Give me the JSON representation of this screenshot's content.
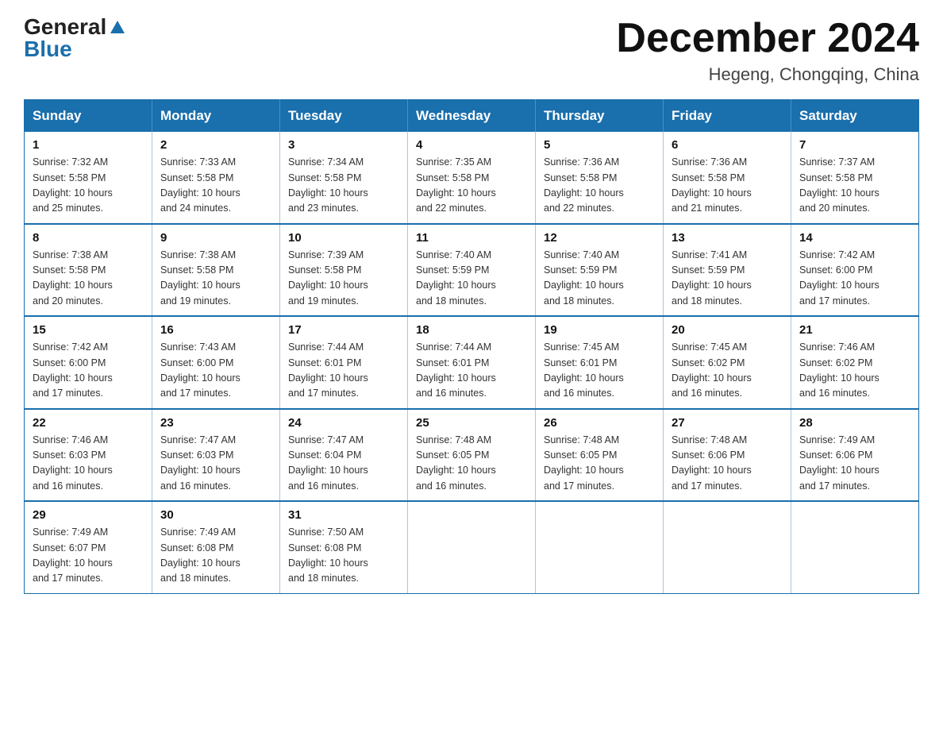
{
  "header": {
    "logo_general": "General",
    "logo_blue": "Blue",
    "month_title": "December 2024",
    "location": "Hegeng, Chongqing, China"
  },
  "weekdays": [
    "Sunday",
    "Monday",
    "Tuesday",
    "Wednesday",
    "Thursday",
    "Friday",
    "Saturday"
  ],
  "weeks": [
    [
      {
        "day": "1",
        "sunrise": "7:32 AM",
        "sunset": "5:58 PM",
        "daylight": "10 hours and 25 minutes."
      },
      {
        "day": "2",
        "sunrise": "7:33 AM",
        "sunset": "5:58 PM",
        "daylight": "10 hours and 24 minutes."
      },
      {
        "day": "3",
        "sunrise": "7:34 AM",
        "sunset": "5:58 PM",
        "daylight": "10 hours and 23 minutes."
      },
      {
        "day": "4",
        "sunrise": "7:35 AM",
        "sunset": "5:58 PM",
        "daylight": "10 hours and 22 minutes."
      },
      {
        "day": "5",
        "sunrise": "7:36 AM",
        "sunset": "5:58 PM",
        "daylight": "10 hours and 22 minutes."
      },
      {
        "day": "6",
        "sunrise": "7:36 AM",
        "sunset": "5:58 PM",
        "daylight": "10 hours and 21 minutes."
      },
      {
        "day": "7",
        "sunrise": "7:37 AM",
        "sunset": "5:58 PM",
        "daylight": "10 hours and 20 minutes."
      }
    ],
    [
      {
        "day": "8",
        "sunrise": "7:38 AM",
        "sunset": "5:58 PM",
        "daylight": "10 hours and 20 minutes."
      },
      {
        "day": "9",
        "sunrise": "7:38 AM",
        "sunset": "5:58 PM",
        "daylight": "10 hours and 19 minutes."
      },
      {
        "day": "10",
        "sunrise": "7:39 AM",
        "sunset": "5:58 PM",
        "daylight": "10 hours and 19 minutes."
      },
      {
        "day": "11",
        "sunrise": "7:40 AM",
        "sunset": "5:59 PM",
        "daylight": "10 hours and 18 minutes."
      },
      {
        "day": "12",
        "sunrise": "7:40 AM",
        "sunset": "5:59 PM",
        "daylight": "10 hours and 18 minutes."
      },
      {
        "day": "13",
        "sunrise": "7:41 AM",
        "sunset": "5:59 PM",
        "daylight": "10 hours and 18 minutes."
      },
      {
        "day": "14",
        "sunrise": "7:42 AM",
        "sunset": "6:00 PM",
        "daylight": "10 hours and 17 minutes."
      }
    ],
    [
      {
        "day": "15",
        "sunrise": "7:42 AM",
        "sunset": "6:00 PM",
        "daylight": "10 hours and 17 minutes."
      },
      {
        "day": "16",
        "sunrise": "7:43 AM",
        "sunset": "6:00 PM",
        "daylight": "10 hours and 17 minutes."
      },
      {
        "day": "17",
        "sunrise": "7:44 AM",
        "sunset": "6:01 PM",
        "daylight": "10 hours and 17 minutes."
      },
      {
        "day": "18",
        "sunrise": "7:44 AM",
        "sunset": "6:01 PM",
        "daylight": "10 hours and 16 minutes."
      },
      {
        "day": "19",
        "sunrise": "7:45 AM",
        "sunset": "6:01 PM",
        "daylight": "10 hours and 16 minutes."
      },
      {
        "day": "20",
        "sunrise": "7:45 AM",
        "sunset": "6:02 PM",
        "daylight": "10 hours and 16 minutes."
      },
      {
        "day": "21",
        "sunrise": "7:46 AM",
        "sunset": "6:02 PM",
        "daylight": "10 hours and 16 minutes."
      }
    ],
    [
      {
        "day": "22",
        "sunrise": "7:46 AM",
        "sunset": "6:03 PM",
        "daylight": "10 hours and 16 minutes."
      },
      {
        "day": "23",
        "sunrise": "7:47 AM",
        "sunset": "6:03 PM",
        "daylight": "10 hours and 16 minutes."
      },
      {
        "day": "24",
        "sunrise": "7:47 AM",
        "sunset": "6:04 PM",
        "daylight": "10 hours and 16 minutes."
      },
      {
        "day": "25",
        "sunrise": "7:48 AM",
        "sunset": "6:05 PM",
        "daylight": "10 hours and 16 minutes."
      },
      {
        "day": "26",
        "sunrise": "7:48 AM",
        "sunset": "6:05 PM",
        "daylight": "10 hours and 17 minutes."
      },
      {
        "day": "27",
        "sunrise": "7:48 AM",
        "sunset": "6:06 PM",
        "daylight": "10 hours and 17 minutes."
      },
      {
        "day": "28",
        "sunrise": "7:49 AM",
        "sunset": "6:06 PM",
        "daylight": "10 hours and 17 minutes."
      }
    ],
    [
      {
        "day": "29",
        "sunrise": "7:49 AM",
        "sunset": "6:07 PM",
        "daylight": "10 hours and 17 minutes."
      },
      {
        "day": "30",
        "sunrise": "7:49 AM",
        "sunset": "6:08 PM",
        "daylight": "10 hours and 18 minutes."
      },
      {
        "day": "31",
        "sunrise": "7:50 AM",
        "sunset": "6:08 PM",
        "daylight": "10 hours and 18 minutes."
      },
      null,
      null,
      null,
      null
    ]
  ],
  "labels": {
    "sunrise": "Sunrise:",
    "sunset": "Sunset:",
    "daylight": "Daylight:"
  }
}
